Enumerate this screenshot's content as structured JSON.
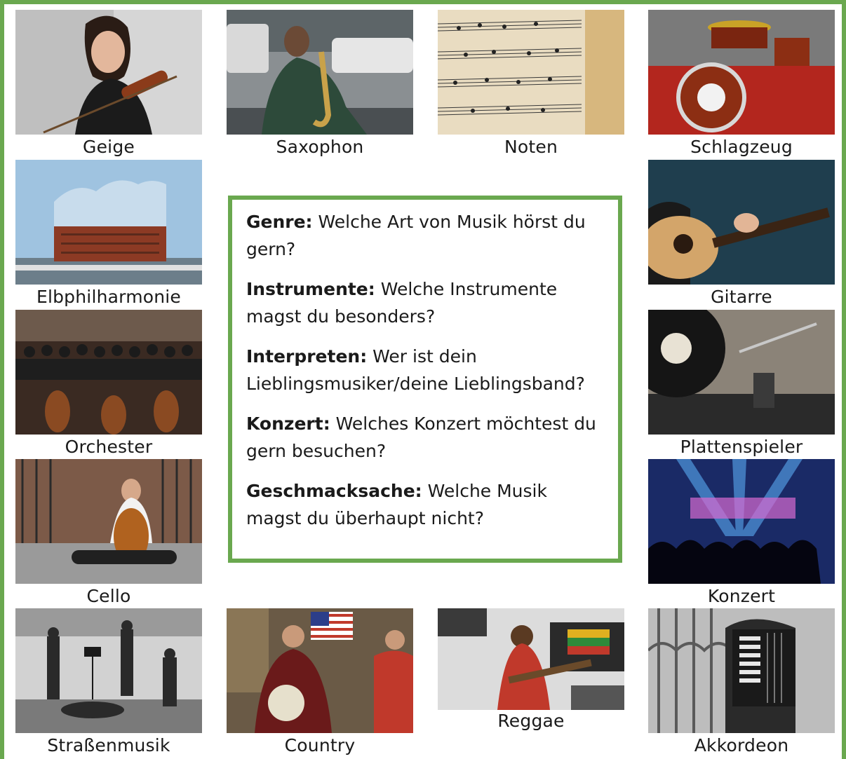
{
  "colors": {
    "frame": "#6aa84f",
    "text": "#1a1a1a"
  },
  "tiles": [
    {
      "caption": "Geige",
      "image": "violinist-photo"
    },
    {
      "caption": "Saxophon",
      "image": "saxophone-player-photo"
    },
    {
      "caption": "Noten",
      "image": "sheet-music-photo"
    },
    {
      "caption": "Schlagzeug",
      "image": "drum-kit-photo"
    },
    {
      "caption": "Elbphilharmonie",
      "image": "elbphilharmonie-photo"
    },
    {
      "caption": "Gitarre",
      "image": "acoustic-guitar-photo"
    },
    {
      "caption": "Orchester",
      "image": "orchestra-photo"
    },
    {
      "caption": "Plattenspieler",
      "image": "turntable-photo"
    },
    {
      "caption": "Cello",
      "image": "cellist-photo"
    },
    {
      "caption": "Konzert",
      "image": "concert-crowd-photo"
    },
    {
      "caption": "Straßenmusik",
      "image": "street-musicians-photo"
    },
    {
      "caption": "Country",
      "image": "country-band-photo"
    },
    {
      "caption": "Reggae",
      "image": "reggae-bassist-photo"
    },
    {
      "caption": "Akkordeon",
      "image": "accordion-player-photo"
    }
  ],
  "questions": [
    {
      "term": "Genre:",
      "text": " Welche Art von Musik hörst du gern?"
    },
    {
      "term": "Instrumente:",
      "text": " Welche Instrumente magst du besonders?"
    },
    {
      "term": "Interpreten:",
      "text": " Wer ist dein Lieblingsmusiker/deine Lieblingsband?"
    },
    {
      "term": "Konzert:",
      "text": " Welches Konzert möchtest du gern besuchen?"
    },
    {
      "term": "Geschmacksache:",
      "text": " Welche Musik magst du überhaupt nicht?"
    }
  ]
}
